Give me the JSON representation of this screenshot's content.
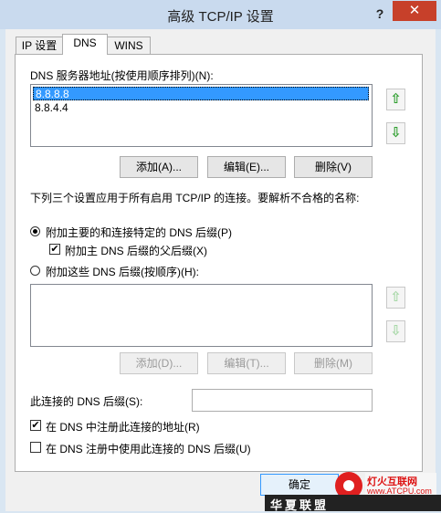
{
  "window": {
    "title": "高级 TCP/IP 设置",
    "help": "?",
    "close": "✕"
  },
  "tabs": [
    {
      "label": "IP 设置",
      "active": false
    },
    {
      "label": "DNS",
      "active": true
    },
    {
      "label": "WINS",
      "active": false
    }
  ],
  "dns_servers": {
    "label": "DNS 服务器地址(按使用顺序排列)(N):",
    "items": [
      "8.8.8.8",
      "8.8.4.4"
    ],
    "selected_index": 0
  },
  "server_buttons": {
    "add": "添加(A)...",
    "edit": "编辑(E)...",
    "remove": "删除(V)"
  },
  "description": "下列三个设置应用于所有启用 TCP/IP 的连接。要解析不合格的名称:",
  "options": {
    "primary_suffix": {
      "label": "附加主要的和连接特定的 DNS 后缀(P)",
      "selected": true
    },
    "parent_suffix": {
      "label": "附加主 DNS 后缀的父后缀(X)",
      "checked": true
    },
    "these_suffixes": {
      "label": "附加这些 DNS 后缀(按顺序)(H):",
      "selected": false
    }
  },
  "suffix_buttons": {
    "add": "添加(D)...",
    "edit": "编辑(T)...",
    "remove": "删除(M)"
  },
  "connection_suffix": {
    "label": "此连接的 DNS 后缀(S):",
    "value": ""
  },
  "register": {
    "label": "在 DNS 中注册此连接的地址(R)",
    "checked": true
  },
  "use_suffix": {
    "label": "在 DNS 注册中使用此连接的 DNS 后缀(U)",
    "checked": false
  },
  "footer": {
    "ok": "确定"
  },
  "watermark": {
    "cn": "灯火互联网",
    "url": "www.ATCPU.com",
    "band": "华夏联盟"
  },
  "icons": {
    "up": "arrow-up-icon",
    "down": "arrow-down-icon"
  },
  "colors": {
    "selection": "#3399ff",
    "arrow_enabled": "#2e9e2e",
    "arrow_disabled": "#a8d8a8",
    "close": "#c7402a",
    "titlebar": "#c9daee"
  }
}
